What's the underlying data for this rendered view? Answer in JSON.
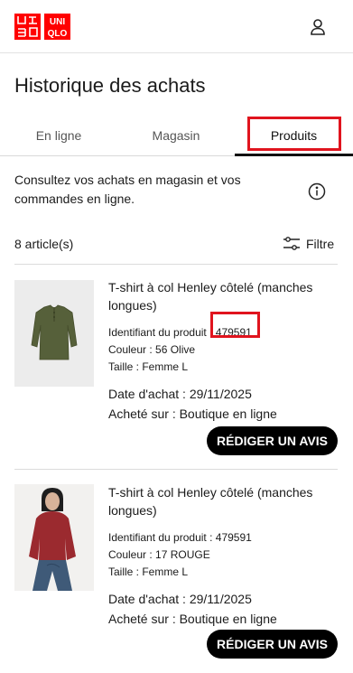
{
  "header": {
    "logo_text": [
      "UNI",
      "QLO",
      "ユニ",
      "クロ"
    ],
    "logo_icon": "uniqlo-logo",
    "account_icon": "user-icon",
    "brand_color": "#ff0000"
  },
  "page": {
    "title": "Historique des achats"
  },
  "tabs": [
    {
      "label": "En ligne",
      "active": false
    },
    {
      "label": "Magasin",
      "active": false
    },
    {
      "label": "Produits",
      "active": true
    }
  ],
  "intro": {
    "text": "Consultez vos achats en magasin et vos commandes en ligne.",
    "info_icon": "info-icon"
  },
  "list": {
    "count": "8 article(s)",
    "filter_label": "Filtre",
    "filter_icon": "sliders-icon"
  },
  "products": [
    {
      "name": "T-shirt à col Henley côtelé (manches longues)",
      "id_label": "Identifiant du produit :",
      "id_value": "479591",
      "color": "Couleur : 56 Olive",
      "size": "Taille : Femme L",
      "date": "Date d'achat : 29/11/2025",
      "purchased_at": "Acheté sur : Boutique en ligne",
      "review_label": "RÉDIGER UN AVIS",
      "image_color": "#56603a"
    },
    {
      "name": "T-shirt à col Henley côtelé (manches longues)",
      "id_label": "Identifiant du produit :",
      "id_value": "479591",
      "color": "Couleur : 17 ROUGE",
      "size": "Taille : Femme L",
      "date": "Date d'achat : 29/11/2025",
      "purchased_at": "Acheté sur : Boutique en ligne",
      "review_label": "RÉDIGER UN AVIS",
      "image_color": "#9b2a2f"
    }
  ],
  "highlight_color": "#e0141e"
}
